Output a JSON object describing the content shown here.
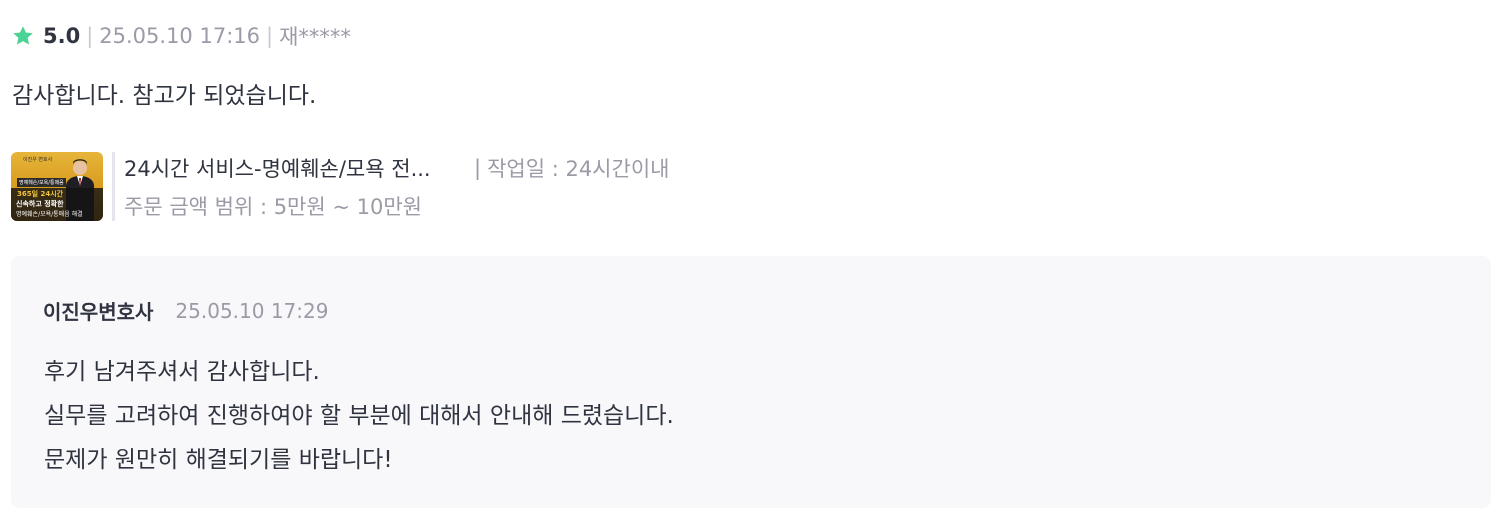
{
  "review": {
    "rating": "5.0",
    "separator": "|",
    "date": "25.05.10 17:16",
    "reviewer": "재*****",
    "text": "감사합니다. 참고가 되었습니다.",
    "star_color": "#4ad395",
    "star_icon": "star-icon"
  },
  "service": {
    "title": "24시간 서비스-명예훼손/모욕 전...",
    "separator": "|",
    "work_label": "작업일 : 24시간이내",
    "price_label": "주문 금액 범위 : 5만원 ~ 10만원",
    "thumbnail": {
      "top_tag": "이진우 변호사",
      "badge": "명예훼손/모욕/통매음",
      "line1": "365일 24시간",
      "line2": "신속하고 정확한",
      "line3": "명예훼손/모욕/통매음 해결"
    }
  },
  "reply": {
    "author": "이진우변호사",
    "date": "25.05.10 17:29",
    "lines": [
      "후기 남겨주셔서 감사합니다.",
      "실무를 고려하여 진행하여야 할 부분에 대해서 안내해 드렸습니다.",
      "문제가 원만히 해결되기를 바랍니다!"
    ]
  }
}
